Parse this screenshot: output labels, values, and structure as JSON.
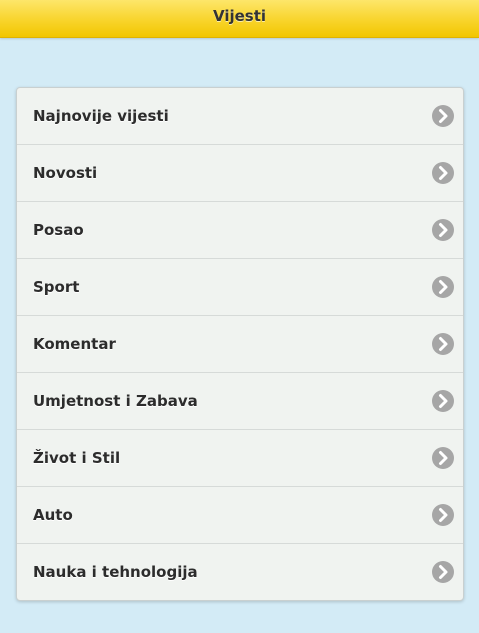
{
  "header": {
    "title": "Vijesti"
  },
  "menu": {
    "items": [
      {
        "label": "Najnovije vijesti",
        "icon": "chevron-right-icon"
      },
      {
        "label": "Novosti",
        "icon": "chevron-right-icon"
      },
      {
        "label": "Posao",
        "icon": "chevron-right-icon"
      },
      {
        "label": "Sport",
        "icon": "chevron-right-icon"
      },
      {
        "label": "Komentar",
        "icon": "chevron-right-icon"
      },
      {
        "label": "Umjetnost i Zabava",
        "icon": "chevron-right-icon"
      },
      {
        "label": "Život i Stil",
        "icon": "chevron-right-icon"
      },
      {
        "label": "Auto",
        "icon": "chevron-right-icon"
      },
      {
        "label": "Nauka i tehnologija",
        "icon": "chevron-right-icon"
      }
    ]
  },
  "colors": {
    "header_bg": "#f8d42b",
    "page_bg": "#d3ebf6",
    "list_bg": "#f0f3f0",
    "chevron_bg": "#a6a6a6"
  }
}
